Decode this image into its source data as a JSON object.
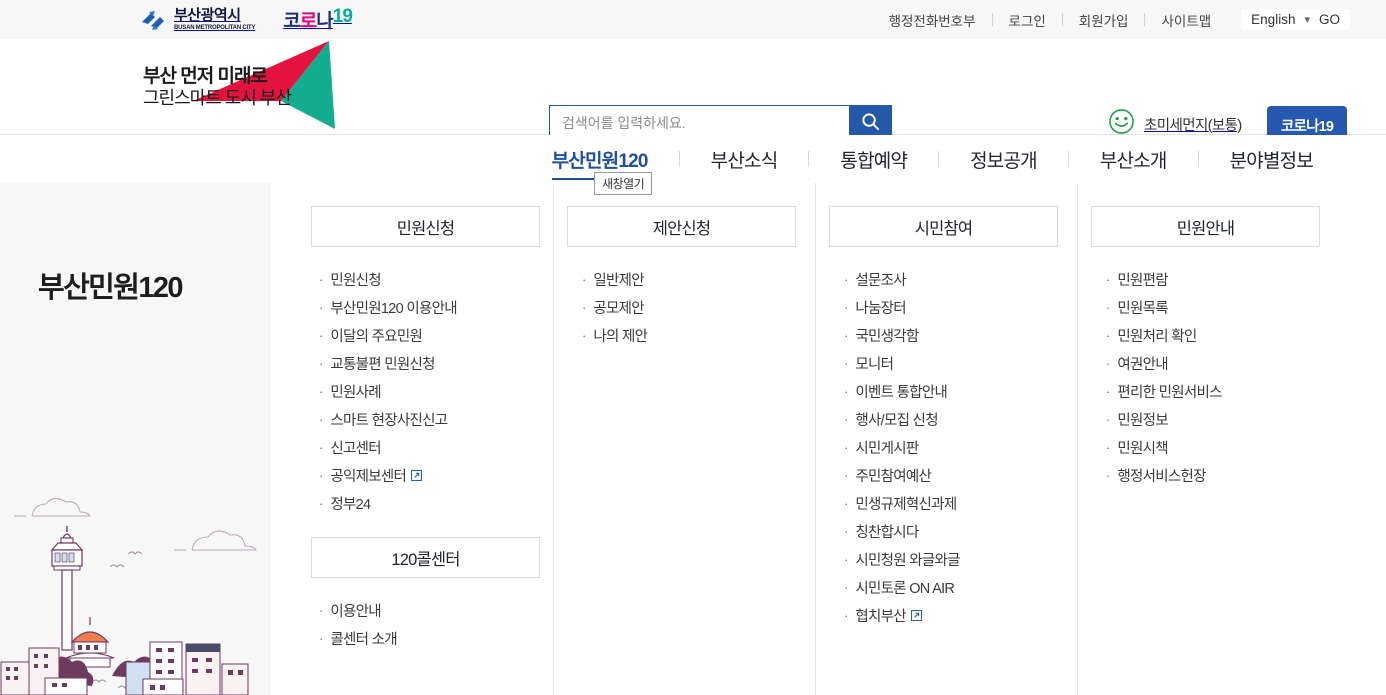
{
  "topbar": {
    "city_logo": {
      "name_kr": "부산광역시",
      "name_en": "BUSAN METROPOLITAN CITY",
      "icon": "busan-city-emblem-icon"
    },
    "corona_logo": {
      "part1": "코",
      "part2": "로",
      "part3": "나",
      "part4": "19"
    },
    "util_links": [
      "행정전화번호부",
      "로그인",
      "회원가입",
      "사이트맵"
    ],
    "language": {
      "selected": "English",
      "caret": "chevron-down-icon",
      "go": "GO"
    }
  },
  "header": {
    "brand": {
      "line1": "부산 먼저 미래로",
      "line2": "그린스마트 도시 부산",
      "icon": "busan-arrow-logo-icon"
    },
    "search": {
      "value": "",
      "placeholder": "검색어를 입력하세요.",
      "button_icon": "search-icon"
    },
    "air_quality": {
      "icon": "smiley-face-icon",
      "label": "초미세먼지(보통)",
      "color": "#1a9e4b"
    },
    "corona_button": {
      "label": "코로나19",
      "color": "#2558ae"
    }
  },
  "gnb": {
    "items": [
      {
        "label": "부산민원120",
        "active": true
      },
      {
        "label": "부산소식",
        "active": false
      },
      {
        "label": "통합예약",
        "active": false
      },
      {
        "label": "정보공개",
        "active": false
      },
      {
        "label": "부산소개",
        "active": false
      },
      {
        "label": "분야별정보",
        "active": false
      }
    ],
    "tooltip": "새창열기",
    "active_color": "#1f4fa3"
  },
  "side_panel": {
    "title": "부산민원120",
    "illustration": "busan-skyline-illustration"
  },
  "mega_menu": {
    "columns": [
      {
        "title": "민원신청",
        "items": [
          {
            "label": "민원신청",
            "external": false
          },
          {
            "label": "부산민원120 이용안내",
            "external": false
          },
          {
            "label": "이달의 주요민원",
            "external": false
          },
          {
            "label": "교통불편 민원신청",
            "external": false
          },
          {
            "label": "민원사례",
            "external": false
          },
          {
            "label": "스마트 현장사진신고",
            "external": false
          },
          {
            "label": "신고센터",
            "external": false
          },
          {
            "label": "공익제보센터",
            "external": true
          },
          {
            "label": "정부24",
            "external": false
          }
        ],
        "subsection": {
          "title": "120콜센터",
          "items": [
            {
              "label": "이용안내",
              "external": false
            },
            {
              "label": "콜센터 소개",
              "external": false
            }
          ]
        }
      },
      {
        "title": "제안신청",
        "items": [
          {
            "label": "일반제안",
            "external": false
          },
          {
            "label": "공모제안",
            "external": false
          },
          {
            "label": "나의 제안",
            "external": false
          }
        ]
      },
      {
        "title": "시민참여",
        "items": [
          {
            "label": "설문조사",
            "external": false
          },
          {
            "label": "나눔장터",
            "external": false
          },
          {
            "label": "국민생각함",
            "external": false
          },
          {
            "label": "모니터",
            "external": false
          },
          {
            "label": "이벤트 통합안내",
            "external": false
          },
          {
            "label": "행사/모집 신청",
            "external": false
          },
          {
            "label": "시민게시판",
            "external": false
          },
          {
            "label": "주민참여예산",
            "external": false
          },
          {
            "label": "민생규제혁신과제",
            "external": false
          },
          {
            "label": "칭찬합시다",
            "external": false
          },
          {
            "label": "시민청원 와글와글",
            "external": false
          },
          {
            "label": "시민토론 ON AIR",
            "external": false
          },
          {
            "label": "협치부산",
            "external": true
          }
        ]
      },
      {
        "title": "민원안내",
        "items": [
          {
            "label": "민원편람",
            "external": false
          },
          {
            "label": "민원목록",
            "external": false
          },
          {
            "label": "민원처리 확인",
            "external": false
          },
          {
            "label": "여권안내",
            "external": false
          },
          {
            "label": "편리한 민원서비스",
            "external": false
          },
          {
            "label": "민원정보",
            "external": false
          },
          {
            "label": "민원시책",
            "external": false
          },
          {
            "label": "행정서비스헌장",
            "external": false
          }
        ]
      }
    ]
  },
  "colors": {
    "primary_blue": "#2458a8",
    "nav_active": "#1f4fa3",
    "brand_red": "#e3123f",
    "brand_teal": "#12ad8e",
    "green": "#1a9e4b",
    "topbar_bg": "#f7f7f8"
  }
}
